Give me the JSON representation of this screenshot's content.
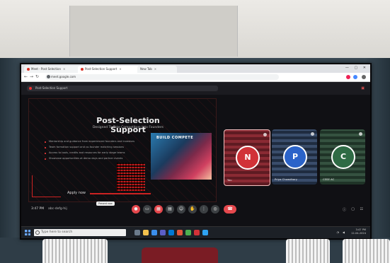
{
  "browser": {
    "tabs": [
      {
        "label": "Meet - Post Selection",
        "active": false
      },
      {
        "label": "Post-Selection Support",
        "active": true
      },
      {
        "label": "New Tab",
        "active": false
      }
    ],
    "window_controls": "— ▢ ✕",
    "url": "meet.google.com"
  },
  "meet": {
    "meeting_title": "Post-Selection Support",
    "header_icon": "people-icon",
    "time": "3:47 PM",
    "meeting_code": "abc-defg-hij",
    "tooltip": "Present now"
  },
  "slide": {
    "title": "Post-Selection Support",
    "subtitle": "Designed To Take Competitors Into Founders",
    "bullets": [
      "Mentorship and guidance from experienced founders and investors",
      "Team formation support and co-founder matching sessions",
      "Access to tools, credits and resources for early stage teams",
      "Showcase opportunities at demo days and partner events"
    ],
    "image_label": "BUILD COMPETE",
    "apply_text": "Apply now"
  },
  "participants": [
    {
      "initial": "N",
      "name": "You",
      "color": "#d13238"
    },
    {
      "initial": "P",
      "name": "Priya Chowdhary",
      "color": "#2b63c9"
    },
    {
      "initial": "C",
      "name": "CSSE AC",
      "color": "#2f6b45"
    }
  ],
  "controls": {
    "mic": "mic-icon",
    "camera": "camera-icon",
    "present": "present-icon",
    "hangup": "hangup-icon"
  },
  "taskbar": {
    "search_placeholder": "Type here to search",
    "tray_time": "3:47 PM",
    "tray_date": "12-04-2024"
  }
}
